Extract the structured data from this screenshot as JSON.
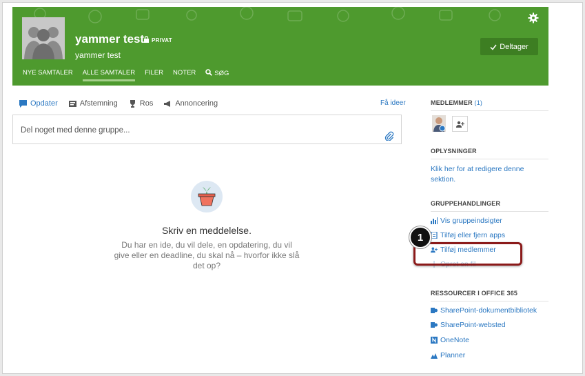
{
  "header": {
    "group_name": "yammer test",
    "privacy_label": "PRIVAT",
    "description": "yammer test",
    "join_label": "Deltager",
    "tabs": [
      {
        "label": "NYE SAMTALER"
      },
      {
        "label": "ALLE SAMTALER"
      },
      {
        "label": "FILER"
      },
      {
        "label": "NOTER"
      },
      {
        "label": "SØG"
      }
    ]
  },
  "publisher": {
    "tabs": [
      {
        "label": "Opdater",
        "icon": "chat-icon"
      },
      {
        "label": "Afstemning",
        "icon": "poll-icon"
      },
      {
        "label": "Ros",
        "icon": "trophy-icon"
      },
      {
        "label": "Annoncering",
        "icon": "megaphone-icon"
      }
    ],
    "ideas_link": "Få ideer",
    "placeholder": "Del noget med denne gruppe..."
  },
  "empty_state": {
    "title": "Skriv en meddelelse.",
    "body": "Du har en ide, du vil dele, en opdatering, du vil give eller en deadline, du skal nå – hvorfor ikke slå det op?"
  },
  "sidebar": {
    "members_heading": "MEDLEMMER",
    "members_count": "(1)",
    "info_heading": "OPLYSNINGER",
    "info_text": "Klik her for at redigere denne sektion.",
    "actions_heading": "GRUPPEHANDLINGER",
    "actions": [
      {
        "label": "Vis gruppeindsigter",
        "icon": "bar-chart-icon"
      },
      {
        "label": "Tilføj eller fjern apps",
        "icon": "apps-icon"
      },
      {
        "label": "Tilføj medlemmer",
        "icon": "add-person-icon"
      },
      {
        "label": "Opret en fil",
        "icon": "file-icon"
      }
    ],
    "resources_heading": "RESSOURCER I OFFICE 365",
    "resources": [
      {
        "label": "SharePoint-dokumentbibliotek",
        "icon": "sharepoint-icon"
      },
      {
        "label": "SharePoint-websted",
        "icon": "sharepoint-icon"
      },
      {
        "label": "OneNote",
        "icon": "onenote-icon"
      },
      {
        "label": "Planner",
        "icon": "planner-icon"
      }
    ]
  },
  "annotation": {
    "step_number": "1"
  },
  "colors": {
    "header_green": "#4e9a2e",
    "link_blue": "#2b78c2",
    "callout_red": "#8b1a1a"
  }
}
